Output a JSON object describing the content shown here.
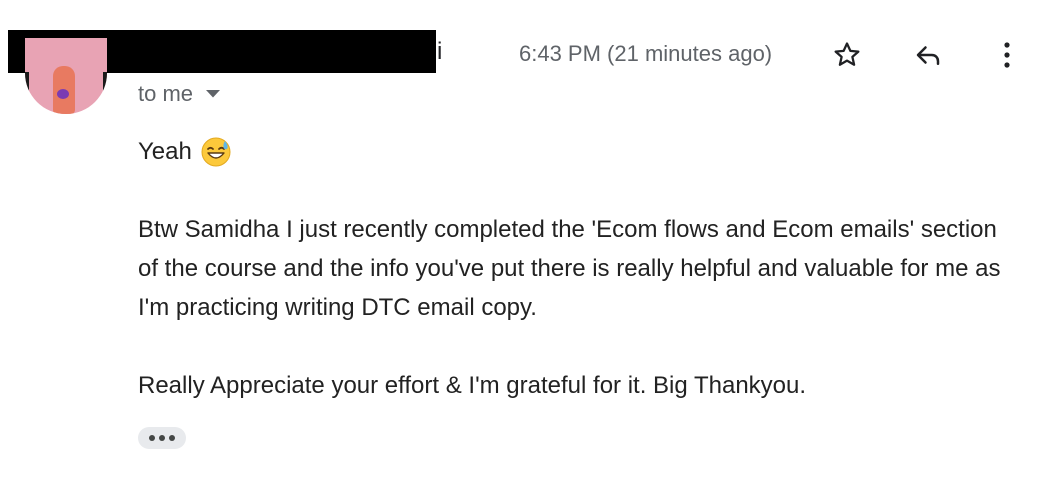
{
  "header": {
    "sender_name_visible_tail": "i",
    "time": "6:43 PM (21 minutes ago)",
    "recipient": "to me"
  },
  "icons": {
    "star": "star-icon",
    "reply": "reply-icon",
    "more": "more-vertical-icon",
    "dropdown": "caret-down-icon",
    "emoji": "grinning-face-with-sweat-emoji"
  },
  "message": {
    "line_1": "Yeah",
    "paragraph_2": "Btw Samidha I just recently completed the 'Ecom flows and Ecom emails' section of the course and the info you've put there is really helpful and valuable for me as I'm practicing writing DTC email copy.",
    "paragraph_3": "Really Appreciate your effort & I'm grateful for it. Big Thankyou."
  },
  "colors": {
    "text": "#202124",
    "secondary_text": "#5f6368",
    "ellipsis_bg": "#e8eaed"
  }
}
